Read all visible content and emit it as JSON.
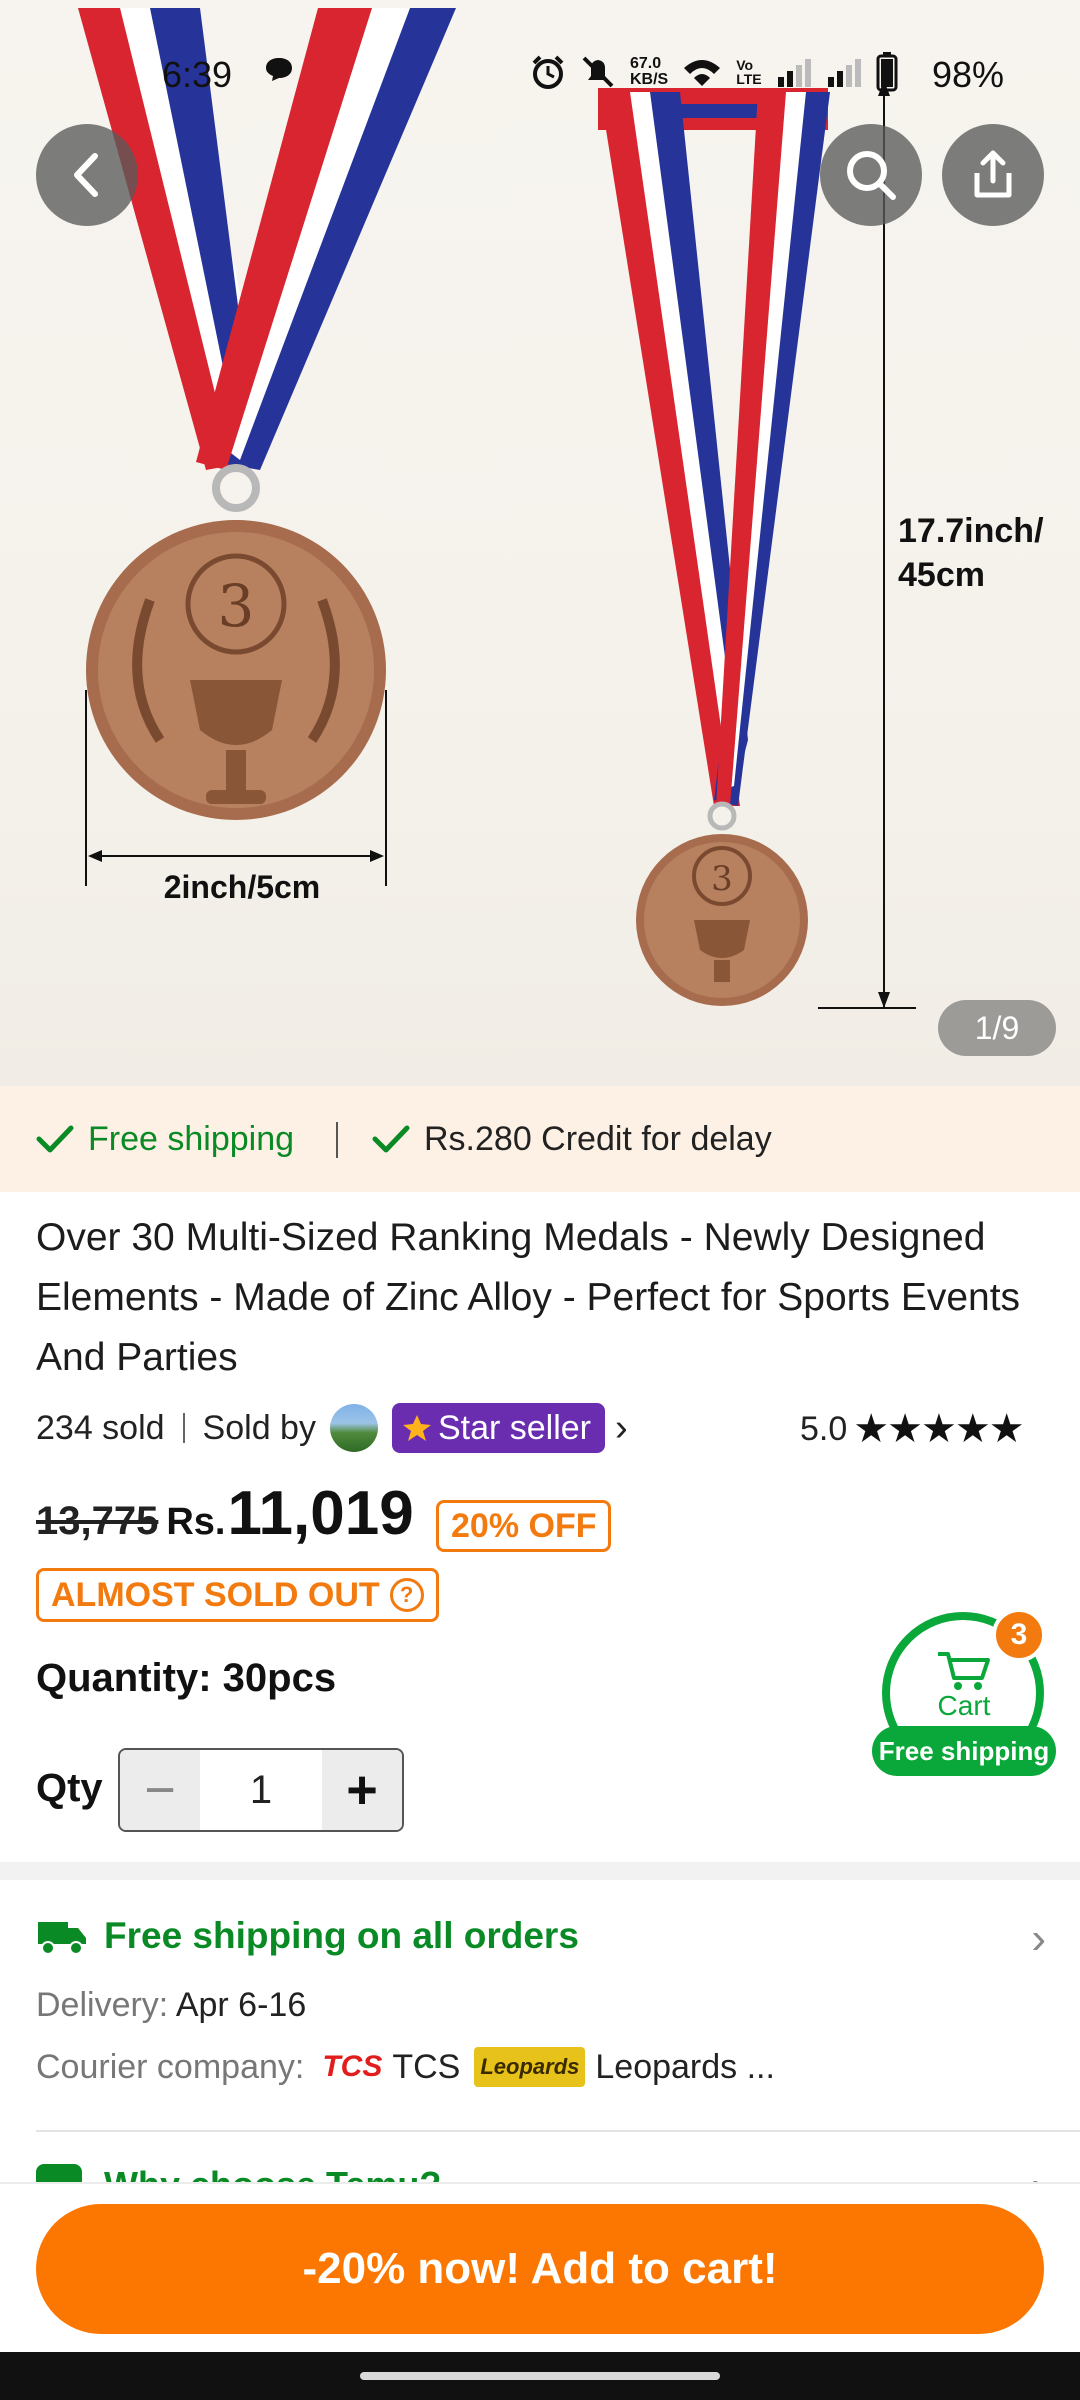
{
  "status_bar": {
    "time": "6:39",
    "network_speed_value": "67.0",
    "network_speed_unit": "KB/S",
    "volte_top": "Vo",
    "volte_bottom": "LTE",
    "battery": "98%"
  },
  "gallery": {
    "image_labels": {
      "height": "17.7inch/\n45cm",
      "height_line1": "17.7inch/",
      "height_line2": "45cm",
      "width": "2inch/5cm"
    },
    "page_indicator": "1/9"
  },
  "shipping_strip": {
    "free_shipping": "Free shipping",
    "credit": "Rs.280 Credit for delay"
  },
  "product": {
    "title": "Over 30 Multi-Sized Ranking Medals - Newly Designed Elements - Made of Zinc Alloy - Perfect for Sports Events And Parties",
    "sold_count": "234 sold",
    "sold_by": "Sold by",
    "seller_badge": "Star seller",
    "rating": "5.0",
    "stars": "★★★★★",
    "old_price": "13,775",
    "currency": "Rs.",
    "price": "11,019",
    "discount": "20% OFF",
    "stock_badge": "ALMOST SOLD OUT",
    "quantity_label": "Quantity: 30pcs",
    "qty_label": "Qty",
    "qty_value": "1"
  },
  "cart_float": {
    "count": "3",
    "label": "Cart",
    "free_shipping": "Free shipping"
  },
  "shipping_info": {
    "headline": "Free shipping on all orders",
    "delivery_label": "Delivery:",
    "delivery_value": "Apr 6-16",
    "courier_label": "Courier company:",
    "courier_1_logo": "TCS",
    "courier_1": "TCS",
    "courier_2_logo": "Leopards",
    "courier_2": "Leopards ..."
  },
  "why_row": {
    "label": "Why choose Temu?"
  },
  "cta": {
    "label": "-20% now! Add to cart!"
  },
  "colors": {
    "accent_orange": "#fb7701",
    "green": "#0a8a25",
    "star_seller_purple": "#6a2db0"
  }
}
